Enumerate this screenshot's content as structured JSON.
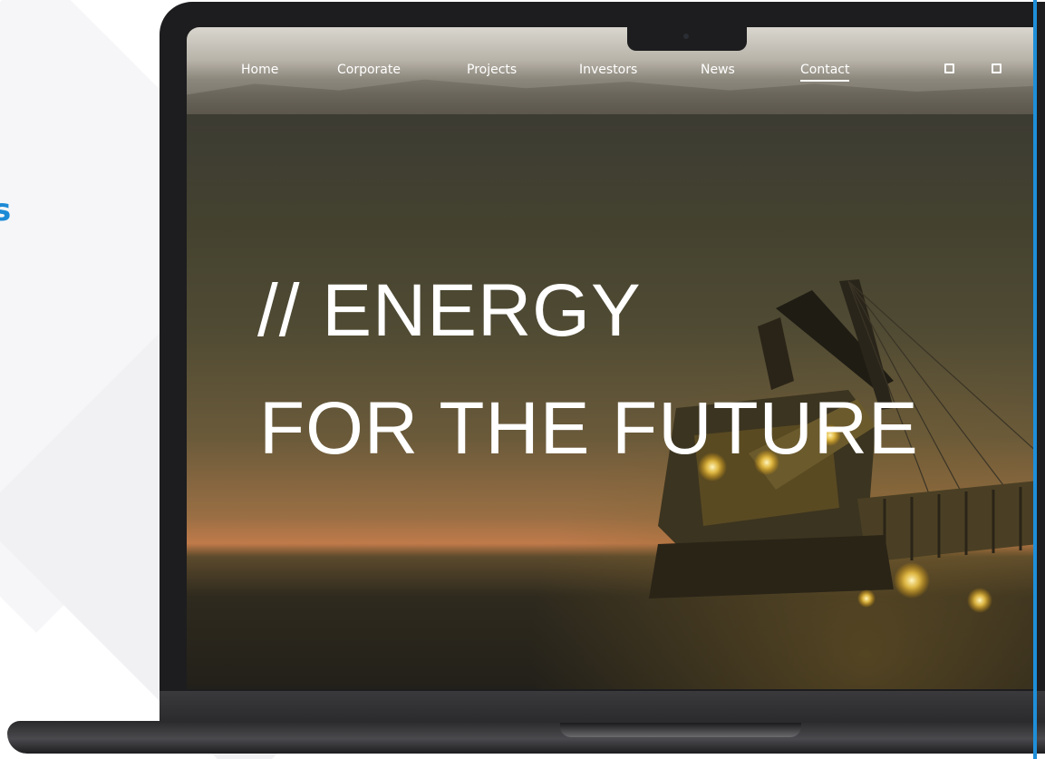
{
  "side_text": "s",
  "nav": {
    "items": [
      {
        "label": "Home",
        "active": false
      },
      {
        "label": "Corporate",
        "active": false
      },
      {
        "label": "Projects",
        "active": false
      },
      {
        "label": "Investors",
        "active": false
      },
      {
        "label": "News",
        "active": false
      },
      {
        "label": "Contact",
        "active": true
      }
    ],
    "icons": [
      "square-outline-icon",
      "square-outline-icon"
    ]
  },
  "hero": {
    "line1": "// ENERGY",
    "line2": "FOR THE FUTURE"
  },
  "colors": {
    "accent": "#1f8fd9",
    "text_on_image": "#ffffff",
    "laptop_body": "#1d1d1f"
  }
}
